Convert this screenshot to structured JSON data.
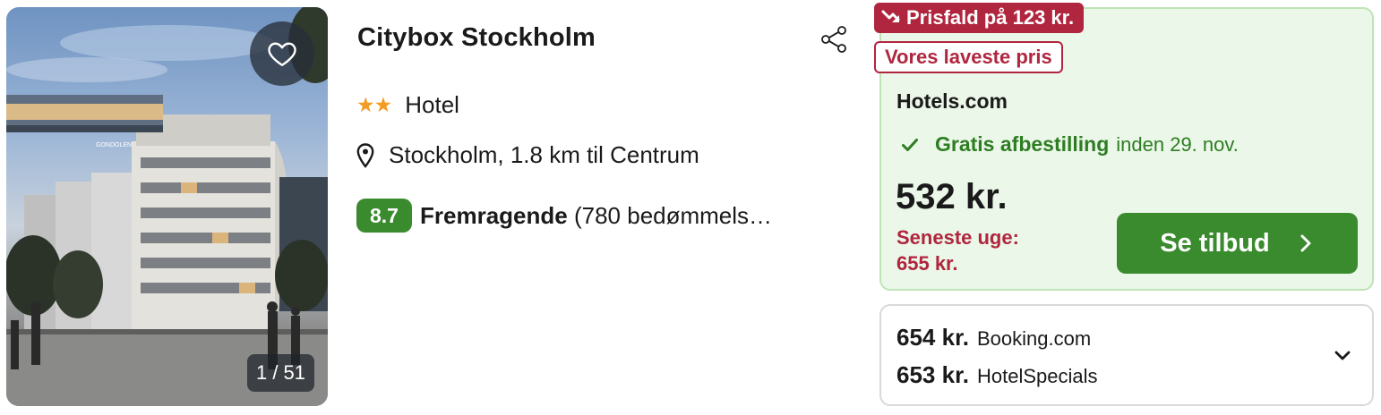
{
  "photo": {
    "counter": "1 / 51",
    "scene_sign": "GONDOLEN"
  },
  "icons": {
    "favorite": "heart-outline-icon",
    "share": "share-icon",
    "location": "map-pin-icon",
    "price_drop": "trending-down-icon",
    "check": "check-icon",
    "cta_arrow": "chevron-right-icon",
    "expand": "chevron-down-icon"
  },
  "hotel": {
    "name": "Citybox Stockholm",
    "stars_glyphs": "★★",
    "star_count": 2,
    "type": "Hotel",
    "location": "Stockholm, 1.8 km til Centrum",
    "rating_score": "8.7",
    "rating_word": "Fremragende",
    "rating_reviews": "(780 bedømmels…"
  },
  "offer": {
    "price_drop_label": "Prisfald på 123 kr.",
    "lowest_label": "Vores laveste pris",
    "provider": "Hotels.com",
    "cancellation_strong": "Gratis afbestilling",
    "cancellation_date": "inden 29. nov.",
    "price": "532 kr.",
    "last_week_label": "Seneste uge:",
    "last_week_price": "655 kr.",
    "cta_label": "Se tilbud"
  },
  "other_deals": [
    {
      "price": "654 kr.",
      "provider": "Booking.com"
    },
    {
      "price": "653 kr.",
      "provider": "HotelSpecials"
    }
  ],
  "colors": {
    "brand_green": "#3a8a2e",
    "text_green": "#2e7d23",
    "deal_red": "#b0263f",
    "panel_green": "#ebf7e8",
    "panel_border": "#bfe4b6",
    "star_orange": "#f59a23"
  }
}
